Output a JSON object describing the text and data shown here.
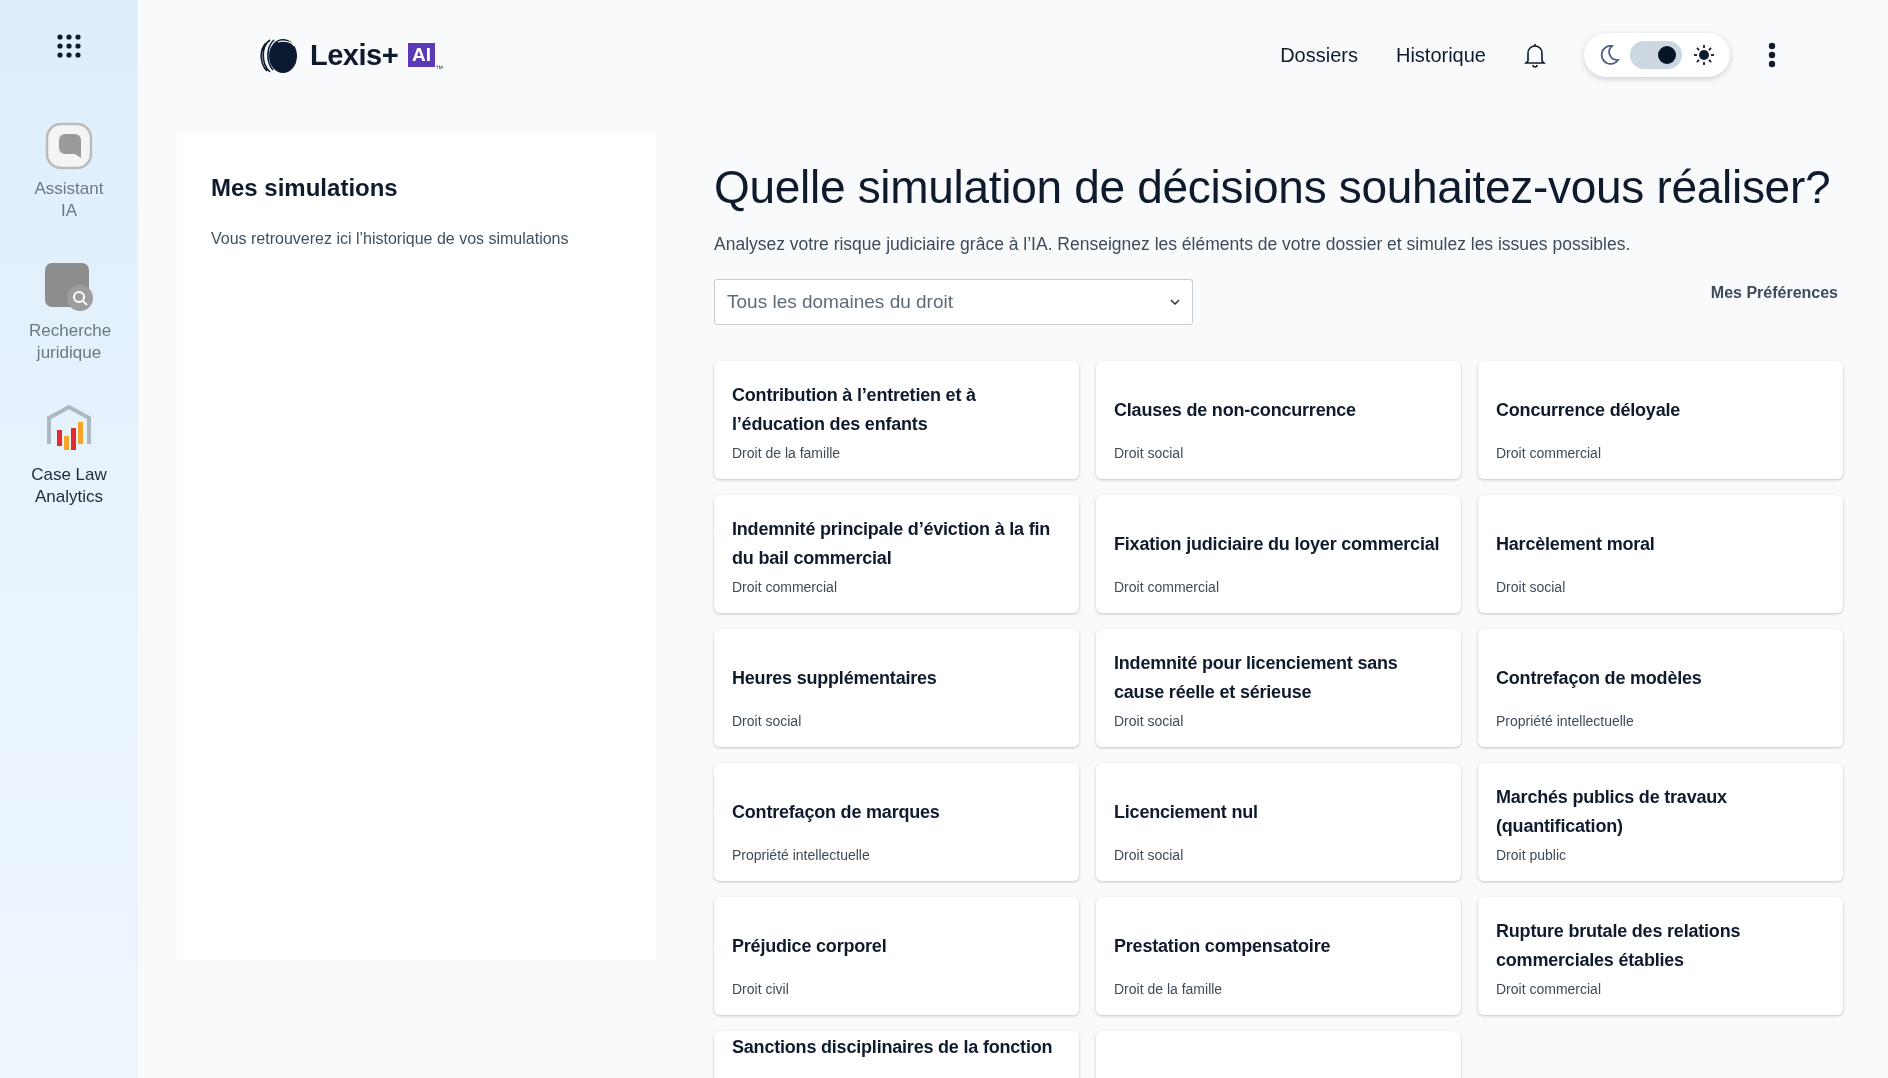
{
  "sidebar": {
    "items": [
      {
        "kind": "chat",
        "label": "Assistant IA"
      },
      {
        "kind": "search",
        "label": "Recherche juridique"
      },
      {
        "kind": "analytics",
        "label": "Case Law Analytics"
      }
    ]
  },
  "header": {
    "logo": {
      "name": "Lexis+",
      "badge": "AI",
      "tm": "™"
    },
    "links": [
      "Dossiers",
      "Historique"
    ],
    "theme_toggle": {
      "light_mode": true
    }
  },
  "history_panel": {
    "title": "Mes simulations",
    "text": "Vous retrouverez ici l’historique de vos simulations"
  },
  "main": {
    "title": "Quelle simulation de décisions souhaitez-vous réaliser?",
    "subtitle": "Analysez votre risque judiciaire grâce à l’IA. Renseignez les éléments de votre dossier et simulez les issues possibles.",
    "domain_select": {
      "placeholder": "Tous les domaines du droit"
    },
    "preferences_link": "Mes Préférences",
    "cards": [
      {
        "kind": "full",
        "title": "Contribution à l’entretien et à l’éducation des enfants",
        "domain": "Droit de la famille"
      },
      {
        "kind": "full",
        "title": "Clauses de non-concurrence",
        "domain": "Droit social"
      },
      {
        "kind": "full",
        "title": "Concurrence déloyale",
        "domain": "Droit commercial"
      },
      {
        "kind": "full",
        "title": "Indemnité principale d’éviction à la fin du bail commercial",
        "domain": "Droit commercial"
      },
      {
        "kind": "full",
        "title": "Fixation judiciaire du loyer commercial",
        "domain": "Droit commercial"
      },
      {
        "kind": "full",
        "title": "Harcèlement moral",
        "domain": "Droit social"
      },
      {
        "kind": "full",
        "title": "Heures supplémentaires",
        "domain": "Droit social"
      },
      {
        "kind": "full",
        "title": "Indemnité pour licenciement sans cause réelle et sérieuse",
        "domain": "Droit social"
      },
      {
        "kind": "full",
        "title": "Contrefaçon de modèles",
        "domain": "Propriété intellectuelle"
      },
      {
        "kind": "full",
        "title": "Contrefaçon de marques",
        "domain": "Propriété intellectuelle"
      },
      {
        "kind": "full",
        "title": "Licenciement nul",
        "domain": "Droit social"
      },
      {
        "kind": "full",
        "title": "Marchés publics de travaux (quantification)",
        "domain": "Droit public"
      },
      {
        "kind": "full",
        "title": "Préjudice corporel",
        "domain": "Droit civil"
      },
      {
        "kind": "full",
        "title": "Prestation compensatoire",
        "domain": "Droit de la famille"
      },
      {
        "kind": "full",
        "title": "Rupture brutale des relations commerciales établies",
        "domain": "Droit commercial"
      },
      {
        "kind": "cut",
        "title": "Sanctions disciplinaires de la fonction"
      },
      {
        "kind": "blank"
      }
    ]
  }
}
